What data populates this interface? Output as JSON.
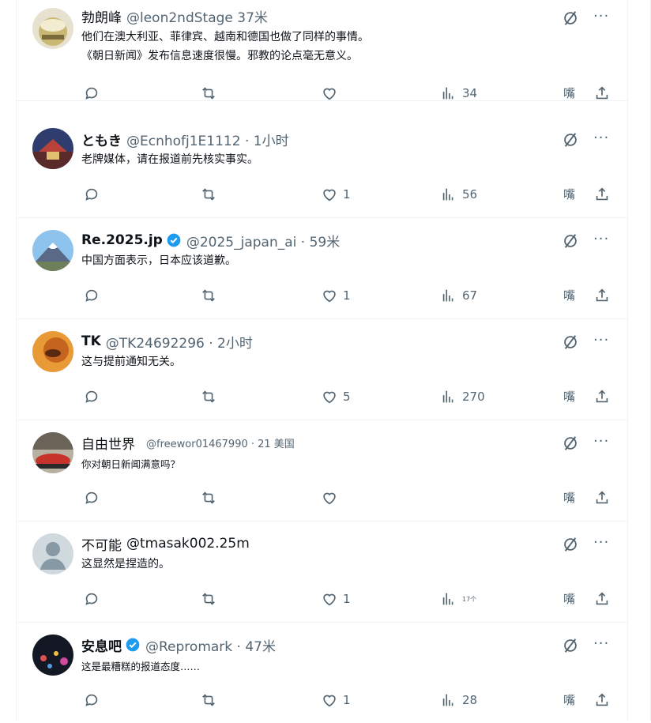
{
  "tweets": [
    {
      "name": "勃朗峰",
      "handle": "@leon2ndStage 37米",
      "lines": [
        "他们在澳大利亚、菲律宾、越南和德国也做了同样的事情。",
        "《朝日新闻》发布信息速度很慢。邪教的论点毫无意义。"
      ],
      "likes": "",
      "views": "34",
      "avatar_colors": [
        "#d9d0b0",
        "#8c7a4a"
      ]
    },
    {
      "name": "ともき",
      "handle": "@Ecnhofj1E1112 · 1小时",
      "lines": [
        "老牌媒体，请在报道前先核实事实。"
      ],
      "likes": "1",
      "views": "56",
      "avatar_colors": [
        "#3a4d8a",
        "#a13b3b"
      ]
    },
    {
      "name": "Re.2025.jp",
      "handle": "@2025_japan_ai · 59米",
      "lines": [
        "中国方面表示，日本应该道歉。"
      ],
      "likes": "1",
      "views": "67",
      "avatar_colors": [
        "#7db6e8",
        "#e7e9ee"
      ]
    },
    {
      "name": "TK",
      "handle": "@TK24692296 · 2小时",
      "lines": [
        "这与提前通知无关。"
      ],
      "likes": "5",
      "views": "270",
      "avatar_colors": [
        "#e8a23c",
        "#b5561f"
      ]
    },
    {
      "name": "自由世界",
      "handle": "@freewor01467990 · 21 美国",
      "lines": [
        "你对朝日新闻满意吗？"
      ],
      "likes": "",
      "views": "",
      "avatar_colors": [
        "#c93b2e",
        "#8c8070"
      ]
    },
    {
      "name": "不可能",
      "handle": "@tmasak002.25m",
      "lines": [
        "这显然是捏造的。"
      ],
      "likes": "1",
      "views": "17个",
      "avatar_colors": [
        "#cfd9de",
        "#8899a6"
      ]
    },
    {
      "name": "安息吧",
      "handle": "@Repromark · 47米",
      "lines": [
        "这是最糟糕的报道态度……"
      ],
      "likes": "1",
      "views": "28",
      "avatar_colors": [
        "#1a1f2e",
        "#d94a4a"
      ]
    }
  ],
  "icons": {
    "reply": "reply-icon",
    "retweet": "retweet-icon",
    "like": "heart-icon",
    "views": "views-icon",
    "share": "share-icon",
    "grok": "grok-icon",
    "more": "more-icon"
  },
  "mute_label": "嘴",
  "more_label": "···",
  "colors": {
    "text": "#0f1419",
    "secondary": "#536471",
    "verified": "#1d9bf0",
    "border": "#eff3f4"
  }
}
